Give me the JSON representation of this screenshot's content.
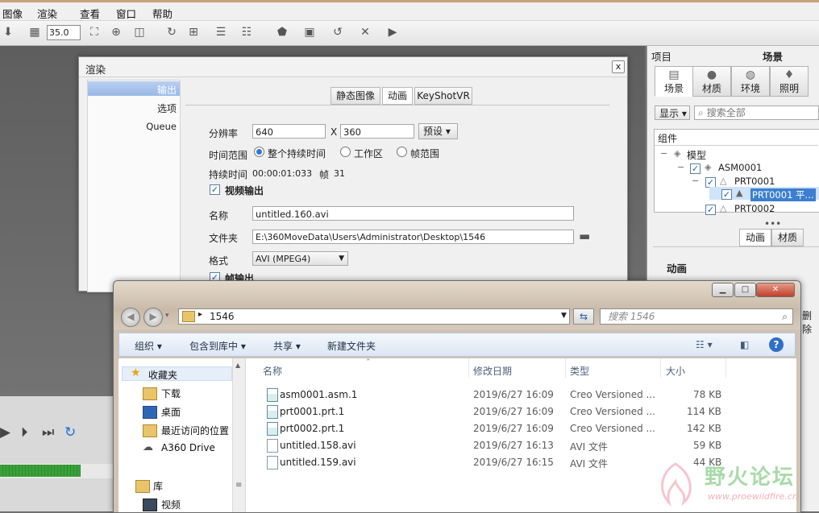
{
  "menubar": {
    "items": [
      "图像",
      "渲染",
      "查看",
      "窗口",
      "帮助"
    ]
  },
  "toolbar": {
    "zoom_value": "35.0"
  },
  "right_panel": {
    "header_left": "项目",
    "header_right": "场景",
    "tabs": [
      "场景",
      "材质",
      "环境",
      "照明"
    ],
    "display_label": "显示",
    "search_placeholder": "搜索全部",
    "tree_header": "组件",
    "tree": [
      {
        "label": "模型"
      },
      {
        "label": "ASM0001"
      },
      {
        "label": "PRT0001"
      },
      {
        "label": "PRT0001 平..."
      },
      {
        "label": "PRT0002"
      }
    ],
    "lower_tabs": [
      "动画",
      "材质"
    ],
    "lower_section": "动画",
    "partial_delete": "删除"
  },
  "render_dialog": {
    "title": "渲染",
    "close": "x",
    "sidebar": [
      "输出",
      "选项",
      "Queue"
    ],
    "tabs": [
      "静态图像",
      "动画",
      "KeyShotVR"
    ],
    "resolution_label": "分辨率",
    "width": "640",
    "x_label": "X",
    "height": "360",
    "preset": "预设",
    "time_range_label": "时间范围",
    "time_options": [
      "整个持续时间",
      "工作区",
      "帧范围"
    ],
    "duration_label": "持续时间",
    "duration_value": "00:00:01:033",
    "frames_label": "帧",
    "frames_value": "31",
    "video_output_label": "视频输出",
    "name_label": "名称",
    "name_value": "untitled.160.avi",
    "folder_label": "文件夹",
    "folder_value": "E:\\360MoveData\\Users\\Administrator\\Desktop\\1546",
    "format_label": "格式",
    "format_value": "AVI (MPEG4)",
    "frame_output_label": "帧输出"
  },
  "explorer": {
    "address": "1546",
    "search_placeholder": "搜索 1546",
    "commands": [
      "组织",
      "包含到库中",
      "共享",
      "新建文件夹"
    ],
    "nav": [
      "收藏夹",
      "下载",
      "桌面",
      "最近访问的位置",
      "A360 Drive",
      "库",
      "视频"
    ],
    "columns": [
      "名称",
      "修改日期",
      "类型",
      "大小"
    ],
    "files": [
      {
        "name": "asm0001.asm.1",
        "date": "2019/6/27 16:09",
        "type": "Creo Versioned ...",
        "size": "78 KB"
      },
      {
        "name": "prt0001.prt.1",
        "date": "2019/6/27 16:09",
        "type": "Creo Versioned ...",
        "size": "114 KB"
      },
      {
        "name": "prt0002.prt.1",
        "date": "2019/6/27 16:09",
        "type": "Creo Versioned ...",
        "size": "142 KB"
      },
      {
        "name": "untitled.158.avi",
        "date": "2019/6/27 16:13",
        "type": "AVI 文件",
        "size": "59 KB"
      },
      {
        "name": "untitled.159.avi",
        "date": "2019/6/27 16:15",
        "type": "AVI 文件",
        "size": "44 KB"
      }
    ]
  },
  "watermark": {
    "title": "野火论坛",
    "url": "www.proewildfire.cn"
  }
}
